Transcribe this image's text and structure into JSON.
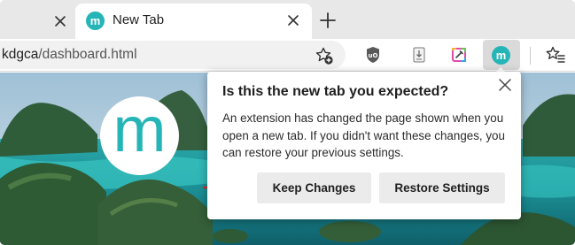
{
  "tabs": {
    "active": {
      "title": "New Tab",
      "favicon_letter": "m"
    }
  },
  "address_bar": {
    "url_host": "kdgca",
    "url_path": "/dashboard.html"
  },
  "toolbar": {
    "extension_m_letter": "m"
  },
  "page": {
    "logo_letter": "m"
  },
  "popup": {
    "title": "Is this the new tab you expected?",
    "body": "An extension has changed the page shown when you open a new tab. If you didn't want these changes, you can restore your previous settings.",
    "keep_label": "Keep Changes",
    "restore_label": "Restore Settings"
  },
  "colors": {
    "brand_teal": "#26b5b6",
    "annotation_red": "#e8261c",
    "tab_strip": "#e8e8e9"
  },
  "icons": [
    "close-icon",
    "plus-icon",
    "favorite-add-icon",
    "ublock-icon",
    "puzzle-extension-icon",
    "color-picker-icon",
    "favorites-icon"
  ]
}
